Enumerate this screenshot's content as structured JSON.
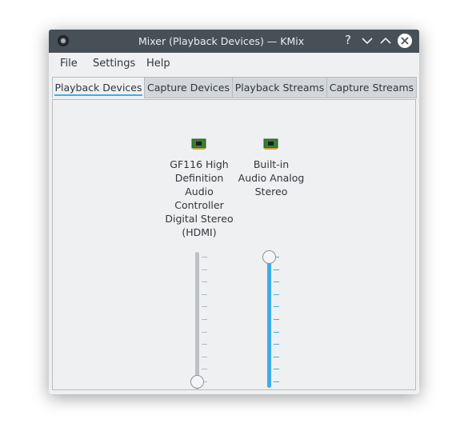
{
  "window": {
    "title": "Mixer (Playback Devices) — KMix",
    "help_glyph": "?",
    "buttons": [
      "help-icon",
      "minimize-icon",
      "maximize-icon",
      "close-icon"
    ]
  },
  "menu": [
    "File",
    "Settings",
    "Help"
  ],
  "tabs": [
    {
      "label": "Playback Devices",
      "active": true
    },
    {
      "label": "Capture Devices",
      "active": false
    },
    {
      "label": "Playback Streams",
      "active": false
    },
    {
      "label": "Capture Streams",
      "active": false
    }
  ],
  "devices": [
    {
      "label": "GF116 High\nDefinition\nAudio\nController\nDigital Stereo\n(HDMI)",
      "icon": "sound-card-icon",
      "volume": 0,
      "control_icon": "speaker-icon"
    },
    {
      "label": "Built-in\nAudio Analog\nStereo",
      "icon": "sound-card-icon",
      "volume": 1,
      "control_icon": "speaker-icon"
    }
  ],
  "colors": {
    "titlebar": "#475057",
    "accent": "#3daee9",
    "background": "#eff0f1"
  }
}
